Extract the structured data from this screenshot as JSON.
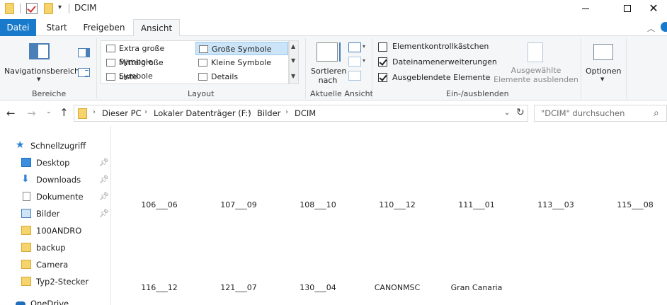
{
  "window": {
    "title": "DCIM",
    "controls": {
      "minimize": "minimize",
      "maximize": "maximize",
      "close": "✕"
    }
  },
  "tabs": [
    {
      "label": "Datei",
      "active": false
    },
    {
      "label": "Start",
      "active": false
    },
    {
      "label": "Freigeben",
      "active": false
    },
    {
      "label": "Ansicht",
      "active": true
    }
  ],
  "ribbon": {
    "panes": {
      "navigation_pane": "Navigationsbereich",
      "group": "Bereiche"
    },
    "layout": {
      "items": [
        {
          "label": "Extra große Symbole",
          "selected": false
        },
        {
          "label": "Große Symbole",
          "selected": true
        },
        {
          "label": "Mittelgroße Symbole",
          "selected": false
        },
        {
          "label": "Kleine Symbole",
          "selected": false
        },
        {
          "label": "Liste",
          "selected": false
        },
        {
          "label": "Details",
          "selected": false
        }
      ],
      "group": "Layout"
    },
    "current_view": {
      "sort_line1": "Sortieren",
      "sort_line2": "nach",
      "group": "Aktuelle Ansicht"
    },
    "show_hide": {
      "checkboxes": [
        {
          "label": "Elementkontrollkästchen",
          "checked": false
        },
        {
          "label": "Dateinamenerweiterungen",
          "checked": true
        },
        {
          "label": "Ausgeblendete Elemente",
          "checked": true
        }
      ],
      "hide_selected_line1": "Ausgewählte",
      "hide_selected_line2": "Elemente ausblenden",
      "group": "Ein-/ausblenden"
    },
    "options": {
      "label": "Optionen"
    }
  },
  "address": {
    "crumbs": [
      "Dieser PC",
      "Lokaler Datenträger (F:)",
      "Bilder",
      "DCIM"
    ],
    "separator": "›"
  },
  "search": {
    "placeholder": "\"DCIM\" durchsuchen"
  },
  "sidebar": {
    "items": [
      {
        "label": "Schnellzugriff",
        "icon": "star-icon",
        "pinned": false
      },
      {
        "label": "Desktop",
        "icon": "desktop-icon",
        "pinned": true
      },
      {
        "label": "Downloads",
        "icon": "download-icon",
        "pinned": true
      },
      {
        "label": "Dokumente",
        "icon": "document-icon",
        "pinned": true
      },
      {
        "label": "Bilder",
        "icon": "pictures-icon",
        "pinned": true
      },
      {
        "label": "100ANDRO",
        "icon": "folder-icon",
        "pinned": false
      },
      {
        "label": "backup",
        "icon": "folder-icon",
        "pinned": false
      },
      {
        "label": "Camera",
        "icon": "folder-icon",
        "pinned": false
      },
      {
        "label": "Typ2-Stecker",
        "icon": "folder-icon",
        "pinned": false
      },
      {
        "label": "OneDrive",
        "icon": "cloud-icon",
        "pinned": false
      }
    ]
  },
  "files": {
    "row1": [
      "106___06",
      "107___09",
      "108___10",
      "110___12",
      "111___01",
      "113___03",
      "115___08"
    ],
    "row2": [
      "116___12",
      "121___07",
      "130___04",
      "CANONMSC",
      "Gran Canaria"
    ]
  },
  "colors": {
    "accent": "#1979ca",
    "folder": "#f6d46b",
    "selection": "#cce4f7"
  }
}
